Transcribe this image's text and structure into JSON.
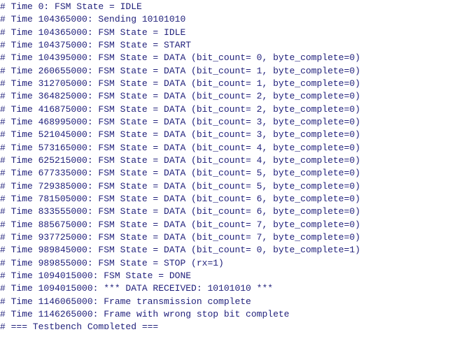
{
  "console": {
    "lines": [
      "# Time 0: FSM State = IDLE",
      "# Time 104365000: Sending 10101010",
      "# Time 104365000: FSM State = IDLE",
      "# Time 104375000: FSM State = START",
      "# Time 104395000: FSM State = DATA (bit_count= 0, byte_complete=0)",
      "# Time 260655000: FSM State = DATA (bit_count= 1, byte_complete=0)",
      "# Time 312705000: FSM State = DATA (bit_count= 1, byte_complete=0)",
      "# Time 364825000: FSM State = DATA (bit_count= 2, byte_complete=0)",
      "# Time 416875000: FSM State = DATA (bit_count= 2, byte_complete=0)",
      "# Time 468995000: FSM State = DATA (bit_count= 3, byte_complete=0)",
      "# Time 521045000: FSM State = DATA (bit_count= 3, byte_complete=0)",
      "# Time 573165000: FSM State = DATA (bit_count= 4, byte_complete=0)",
      "# Time 625215000: FSM State = DATA (bit_count= 4, byte_complete=0)",
      "# Time 677335000: FSM State = DATA (bit_count= 5, byte_complete=0)",
      "# Time 729385000: FSM State = DATA (bit_count= 5, byte_complete=0)",
      "# Time 781505000: FSM State = DATA (bit_count= 6, byte_complete=0)",
      "# Time 833555000: FSM State = DATA (bit_count= 6, byte_complete=0)",
      "# Time 885675000: FSM State = DATA (bit_count= 7, byte_complete=0)",
      "# Time 937725000: FSM State = DATA (bit_count= 7, byte_complete=0)",
      "# Time 989845000: FSM State = DATA (bit_count= 0, byte_complete=1)",
      "# Time 989855000: FSM State = STOP (rx=1)",
      "# Time 1094015000: FSM State = DONE",
      "# Time 1094015000: *** DATA RECEIVED: 10101010 ***",
      "# Time 1146065000: Frame transmission complete",
      "# Time 1146265000: Frame with wrong stop bit complete",
      "# === Testbench Completed ==="
    ],
    "text_color": "#1f1f7a",
    "background_color": "#ffffff"
  }
}
